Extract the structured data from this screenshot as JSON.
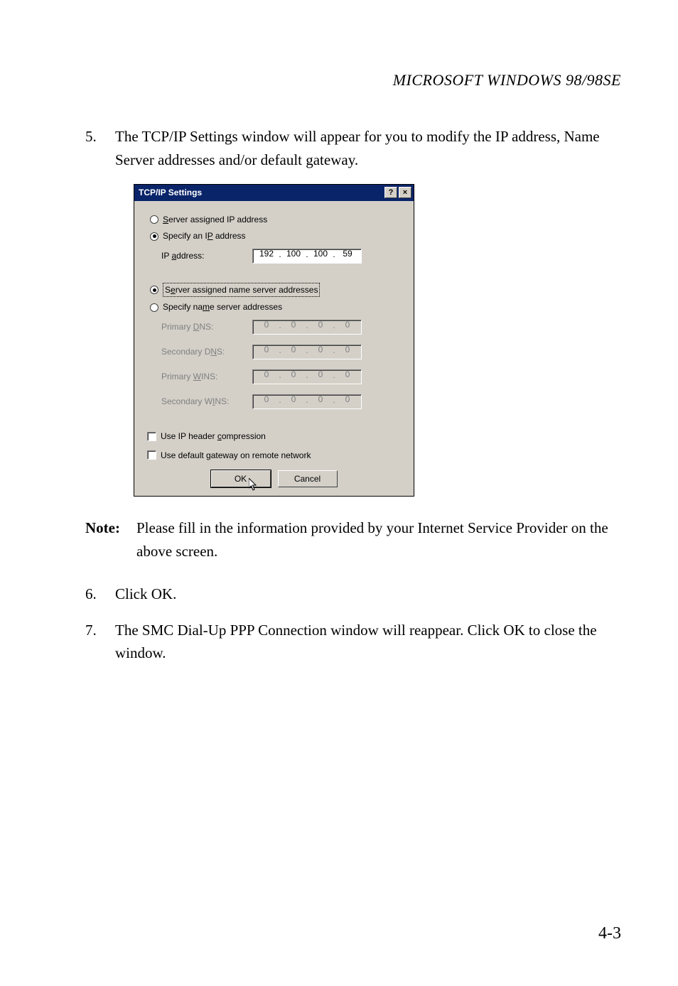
{
  "running_head": "MICROSOFT WINDOWS 98/98SE",
  "steps": {
    "s5": {
      "num": "5.",
      "text": "The TCP/IP Settings window will appear for you to modify the IP address, Name Server addresses and/or default gateway."
    },
    "s6": {
      "num": "6.",
      "text": "Click OK."
    },
    "s7": {
      "num": "7.",
      "text": "The SMC Dial-Up PPP Connection window will reappear. Click OK to close the window."
    }
  },
  "note": {
    "label": "Note:",
    "text": "Please fill in the information provided by your Internet Service Provider on the above screen."
  },
  "page_number": "4-3",
  "dialog": {
    "title": "TCP/IP Settings",
    "help_btn": "?",
    "close_btn": "×",
    "radio_server_ip": "Server assigned IP address",
    "radio_specify_ip": "Specify an IP address",
    "ip_address_label": "IP address:",
    "ip_address": {
      "a": "192",
      "b": "100",
      "c": "100",
      "d": "59"
    },
    "radio_server_ns": "Server assigned name server addresses",
    "radio_specify_ns": "Specify name server addresses",
    "primary_dns_label": "Primary DNS:",
    "secondary_dns_label": "Secondary DNS:",
    "primary_wins_label": "Primary WINS:",
    "secondary_wins_label": "Secondary WINS:",
    "zero": "0",
    "check_compression": "Use IP header compression",
    "check_gateway": "Use default gateway on remote network",
    "ok": "OK",
    "cancel": "Cancel",
    "dot": "."
  }
}
